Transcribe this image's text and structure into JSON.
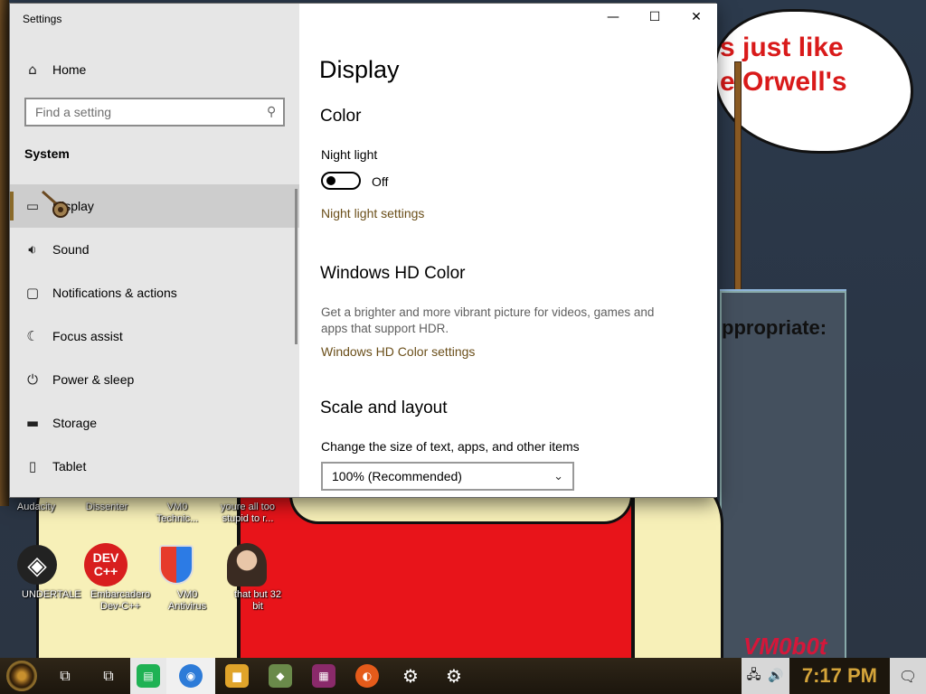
{
  "window": {
    "title": "Settings",
    "controls": {
      "minimize": "—",
      "maximize": "☐",
      "close": "✕"
    }
  },
  "sidebar": {
    "home_label": "Home",
    "search_placeholder": "Find a setting",
    "group_heading": "System",
    "items": [
      {
        "icon": "display-icon",
        "glyph": "▭",
        "label": "Display"
      },
      {
        "icon": "sound-icon",
        "glyph": "🔊",
        "label": "Sound"
      },
      {
        "icon": "notifications-icon",
        "glyph": "▢",
        "label": "Notifications & actions"
      },
      {
        "icon": "focus-assist-icon",
        "glyph": "☾",
        "label": "Focus assist"
      },
      {
        "icon": "power-icon",
        "glyph": "⏻",
        "label": "Power & sleep"
      },
      {
        "icon": "storage-icon",
        "glyph": "▬",
        "label": "Storage"
      },
      {
        "icon": "tablet-icon",
        "glyph": "▯",
        "label": "Tablet"
      }
    ],
    "active_item": "Display"
  },
  "content": {
    "page_title": "Display",
    "color": {
      "heading": "Color",
      "night_light_label": "Night light",
      "night_light_state": "Off",
      "night_light_settings_link": "Night light settings"
    },
    "hd_color": {
      "heading": "Windows HD Color",
      "description": "Get a brighter and more vibrant picture for videos, games and apps that support HDR.",
      "settings_link": "Windows HD Color settings"
    },
    "scale_layout": {
      "heading": "Scale and layout",
      "change_size_label": "Change the size of text, apps, and other items",
      "scale_value": "100% (Recommended)"
    }
  },
  "desktop": {
    "speech_text": "s just like\ne Orwell's",
    "appropriate_text": "ppropriate:",
    "vm_logo": "VM0b0t",
    "top_row_labels": [
      "Audacity",
      "Dissenter",
      "VM0\nTechnic...",
      "youre all too\nstupid to r..."
    ],
    "icons": [
      {
        "name": "undertale-icon",
        "label": "UNDERTALE"
      },
      {
        "name": "dev-cpp-icon",
        "label": "Embarcadero\nDev-C++",
        "glyph": "DEV\nC++"
      },
      {
        "name": "vm0-antivirus-icon",
        "label": "VM0 Antivirus"
      },
      {
        "name": "that-but-32bit-icon",
        "label": "that but 32 bit"
      }
    ]
  },
  "taskbar": {
    "clock": "7:17 PM",
    "apps": [
      {
        "name": "task-view-icon",
        "glyph": "⧉"
      },
      {
        "name": "task-view-2-icon",
        "glyph": "⧉"
      },
      {
        "name": "chat-app-icon",
        "glyph": "▤",
        "color": "#1fb254"
      },
      {
        "name": "chrome-icon",
        "glyph": "◉",
        "color": "#2d7bd8"
      },
      {
        "name": "file-explorer-icon",
        "glyph": "▆",
        "color": "#e0a42a"
      },
      {
        "name": "game-app-icon",
        "glyph": "◆",
        "color": "#6a8a4a"
      },
      {
        "name": "winrar-icon",
        "glyph": "▦",
        "color": "#8a2a6a"
      },
      {
        "name": "firefox-icon",
        "glyph": "◐",
        "color": "#e55b1a"
      },
      {
        "name": "settings-gear-icon",
        "glyph": "⚙",
        "color": "#555555"
      },
      {
        "name": "settings-icon",
        "glyph": "⚙",
        "color": "#2a2a2a"
      }
    ],
    "tray": {
      "network": "🖧",
      "volume": "🔊",
      "notifications": "🗨"
    }
  }
}
